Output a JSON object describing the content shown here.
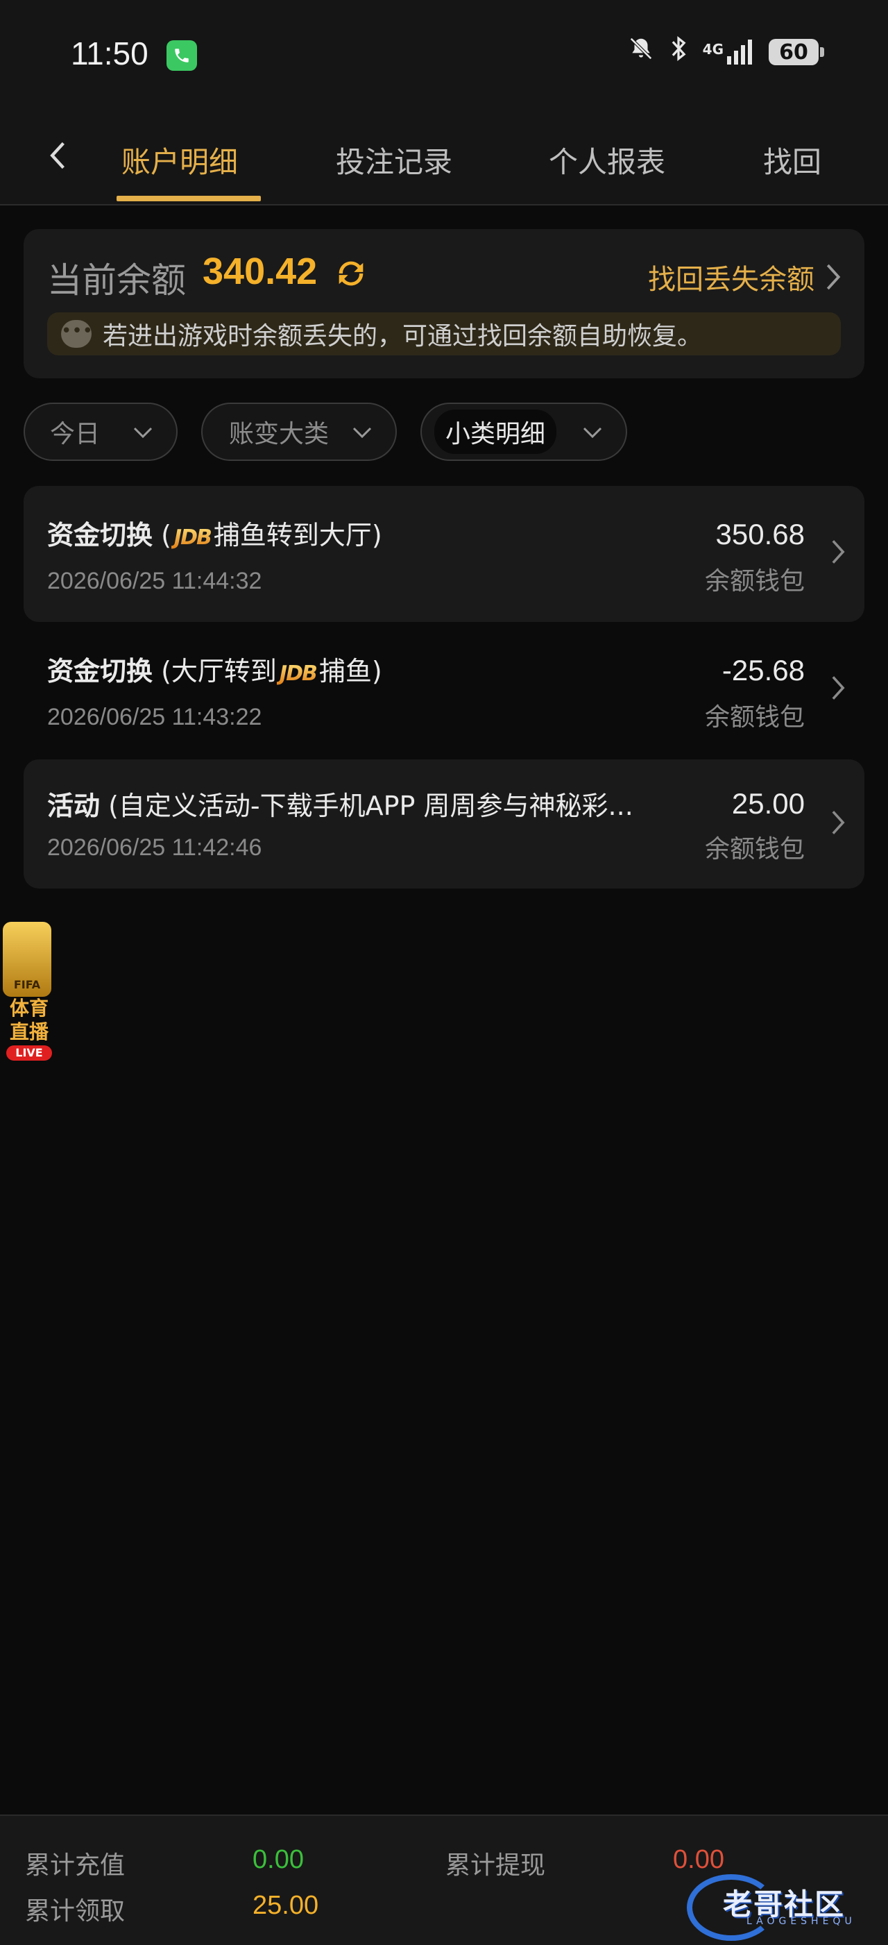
{
  "status_bar": {
    "time": "11:50",
    "network": "4G",
    "battery": "60",
    "icons": [
      "phone-icon",
      "bell-muted-icon",
      "bluetooth-icon",
      "signal-icon",
      "battery-icon"
    ]
  },
  "tabs": [
    {
      "label": "账户明细",
      "active": true
    },
    {
      "label": "投注记录",
      "active": false
    },
    {
      "label": "个人报表",
      "active": false
    },
    {
      "label": "找回",
      "active": false
    }
  ],
  "balance": {
    "label": "当前余额",
    "value": "340.42",
    "recover_label": "找回丢失余额",
    "notice": "若进出游戏时余额丢失的，可通过找回余额自助恢复。"
  },
  "filters": [
    {
      "label": "今日"
    },
    {
      "label": "账变大类"
    },
    {
      "label": "小类明细"
    }
  ],
  "records": [
    {
      "type": "资金切换",
      "detail_pre": " (",
      "logo": "JDB",
      "detail_post": "捕鱼转到大厅)",
      "time": "2026/06/25 11:44:32",
      "amount": "350.68",
      "wallet": "余额钱包"
    },
    {
      "type": "资金切换",
      "detail_pre": " (大厅转到",
      "logo": "JDB",
      "detail_post": "捕鱼)",
      "time": "2026/06/25 11:43:22",
      "amount": "-25.68",
      "wallet": "余额钱包"
    },
    {
      "type": "活动",
      "detail_pre": " (自定义活动-下载手机APP 周周参与神秘彩...",
      "logo": "",
      "detail_post": "",
      "time": "2026/06/25 11:42:46",
      "amount": "25.00",
      "wallet": "余额钱包"
    }
  ],
  "floating_badge": {
    "fifa": "FIFA",
    "line1": "体育",
    "line2": "直播",
    "live": "LIVE"
  },
  "summary": {
    "recharge_label": "累计充值",
    "recharge_value": "0.00",
    "withdraw_label": "累计提现",
    "withdraw_value": "0.00",
    "claim_label": "累计领取",
    "claim_value": "25.00"
  },
  "watermark": {
    "text": "老哥社区",
    "sub": "LAOGESHEQU"
  },
  "colors": {
    "accent": "#e5b04a",
    "balance": "#f5b12a",
    "recharge": "#3bbf3b",
    "withdraw": "#e0503a",
    "claim": "#f5b12a"
  }
}
